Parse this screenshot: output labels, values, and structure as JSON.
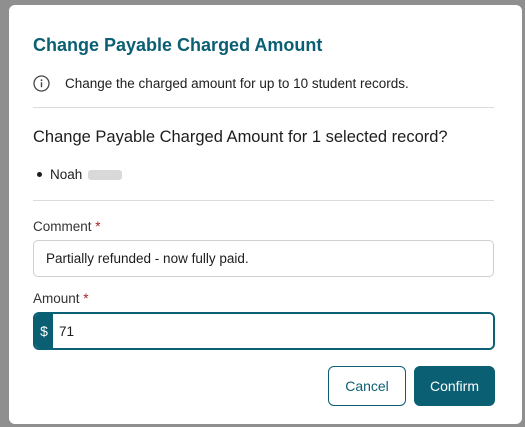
{
  "dialog": {
    "title": "Change Payable Charged Amount",
    "info_text": "Change the charged amount for up to 10 student records.",
    "question": "Change Payable Charged Amount for 1 selected record?",
    "records": [
      {
        "name": "Noah"
      }
    ],
    "comment": {
      "label": "Comment",
      "required_mark": "*",
      "value": "Partially refunded - now fully paid."
    },
    "amount": {
      "label": "Amount",
      "required_mark": "*",
      "currency_symbol": "$",
      "value": "71"
    },
    "buttons": {
      "cancel": "Cancel",
      "confirm": "Confirm"
    }
  },
  "icons": {
    "info": "info-circle-icon"
  },
  "colors": {
    "accent": "#0b5f72",
    "required": "#a1262a",
    "overlay": "#8f8f8f"
  }
}
